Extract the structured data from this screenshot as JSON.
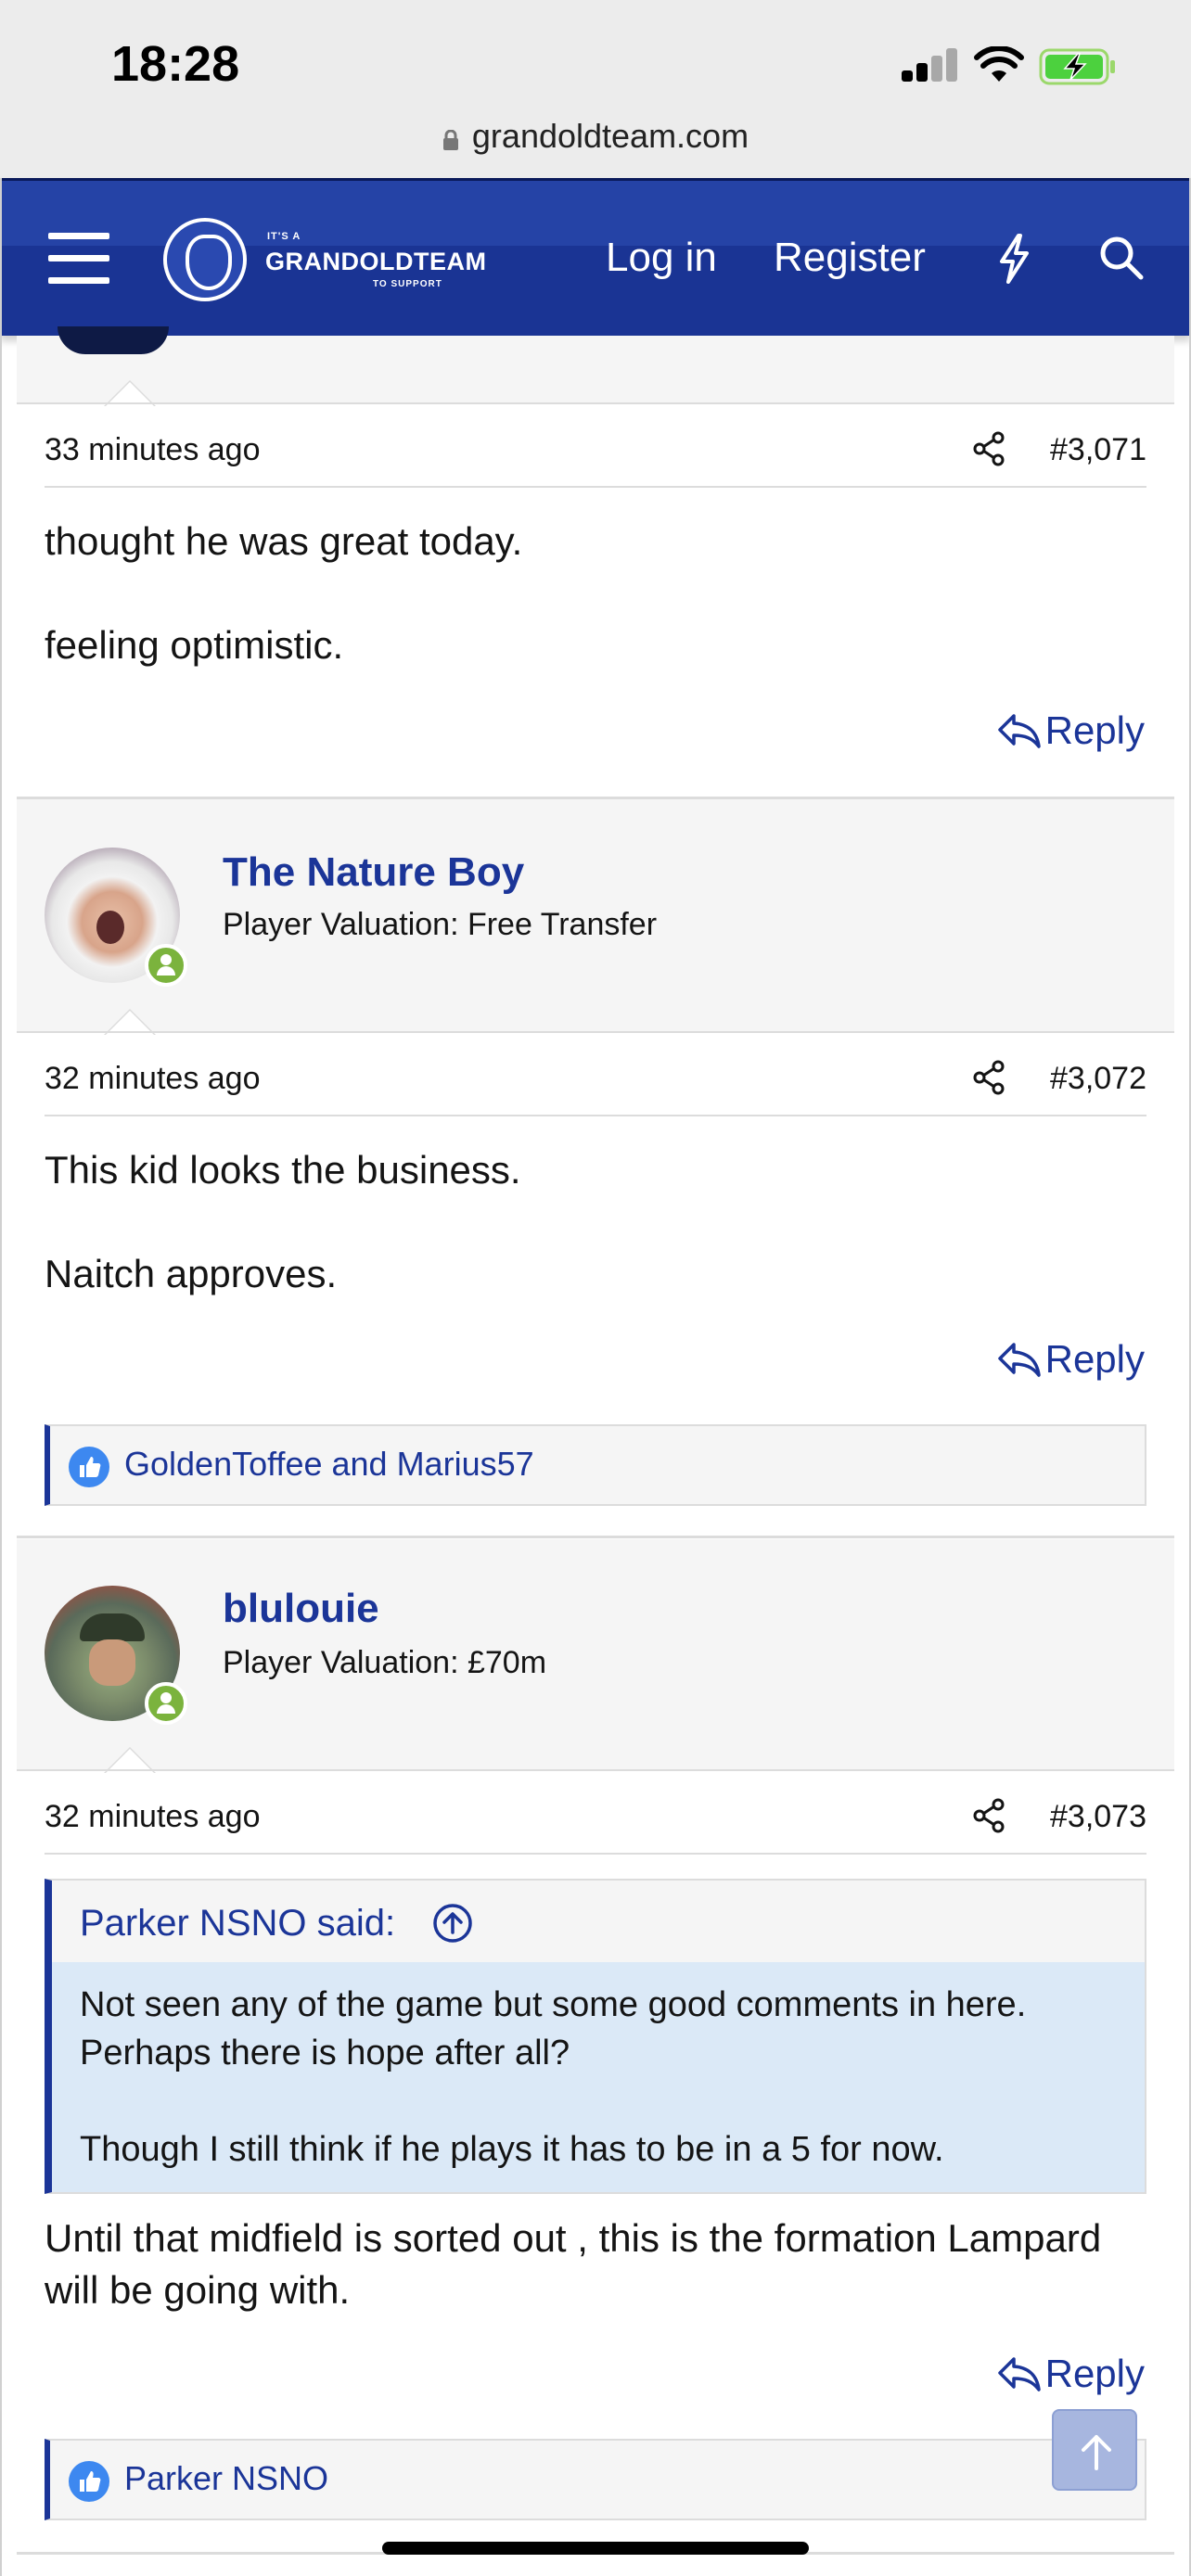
{
  "status_bar": {
    "time": "18:28"
  },
  "browser": {
    "url": "grandoldteam.com"
  },
  "nav": {
    "logo_small": "IT'S A",
    "logo_main": "GRANDOLDTEAM",
    "logo_sub": "TO SUPPORT",
    "login": "Log in",
    "register": "Register"
  },
  "colors": {
    "brand": "#1a3494",
    "link": "#1b3598",
    "online": "#7bb33d",
    "quote_bg": "#dbe9f7"
  },
  "posts": [
    {
      "date": "33 minutes ago",
      "number": "#3,071",
      "paragraphs": [
        "thought he was great today.",
        "feeling optimistic."
      ],
      "reply": "Reply"
    },
    {
      "username": "The Nature Boy",
      "user_title": "Player Valuation: Free Transfer",
      "date": "32 minutes ago",
      "number": "#3,072",
      "paragraphs": [
        "This kid looks the business.",
        "Naitch approves."
      ],
      "reply": "Reply",
      "reactions": "GoldenToffee and Marius57"
    },
    {
      "username": "blulouie",
      "user_title": "Player Valuation: £70m",
      "date": "32 minutes ago",
      "number": "#3,073",
      "quote_author": "Parker NSNO said:",
      "quote_paragraphs": [
        "Not seen any of the game but some good comments in here. Perhaps there is hope after all?",
        "Though I still think if he plays it has to be in a 5 for now."
      ],
      "body": "Until that midfield is sorted out , this is the formation Lampard will be going with.",
      "reply": "Reply",
      "reactions": "Parker NSNO"
    }
  ]
}
